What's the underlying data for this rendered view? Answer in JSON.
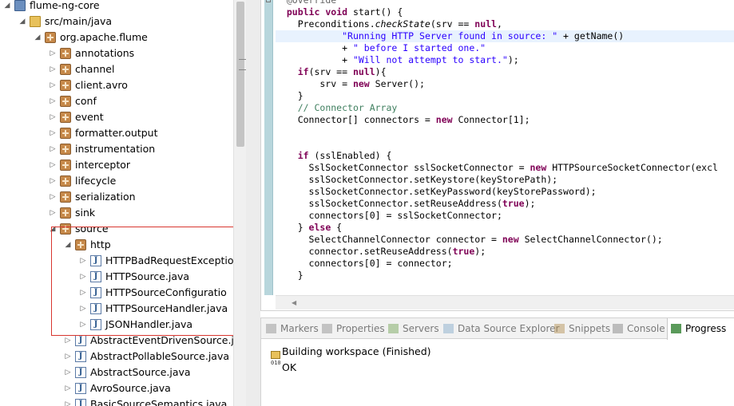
{
  "explorer": {
    "rows": [
      {
        "label": "flume-ng-core",
        "kind": "project",
        "arrow": "expanded",
        "indent": 0
      },
      {
        "label": "src/main/java",
        "kind": "folder",
        "arrow": "expanded",
        "indent": 1
      },
      {
        "label": "org.apache.flume",
        "kind": "package",
        "arrow": "expanded",
        "indent": 2
      },
      {
        "label": "annotations",
        "kind": "package",
        "arrow": "collapsed",
        "indent": 3
      },
      {
        "label": "channel",
        "kind": "package",
        "arrow": "collapsed",
        "indent": 3
      },
      {
        "label": "client.avro",
        "kind": "package",
        "arrow": "collapsed",
        "indent": 3
      },
      {
        "label": "conf",
        "kind": "package",
        "arrow": "collapsed",
        "indent": 3
      },
      {
        "label": "event",
        "kind": "package",
        "arrow": "collapsed",
        "indent": 3
      },
      {
        "label": "formatter.output",
        "kind": "package",
        "arrow": "collapsed",
        "indent": 3
      },
      {
        "label": "instrumentation",
        "kind": "package",
        "arrow": "collapsed",
        "indent": 3
      },
      {
        "label": "interceptor",
        "kind": "package",
        "arrow": "collapsed",
        "indent": 3
      },
      {
        "label": "lifecycle",
        "kind": "package",
        "arrow": "collapsed",
        "indent": 3
      },
      {
        "label": "serialization",
        "kind": "package",
        "arrow": "collapsed",
        "indent": 3
      },
      {
        "label": "sink",
        "kind": "package",
        "arrow": "collapsed",
        "indent": 3
      },
      {
        "label": "source",
        "kind": "package",
        "arrow": "expanded",
        "indent": 3
      },
      {
        "label": "http",
        "kind": "package",
        "arrow": "expanded",
        "indent": 4
      },
      {
        "label": "HTTPBadRequestExceptio",
        "kind": "java",
        "arrow": "collapsed",
        "indent": 5
      },
      {
        "label": "HTTPSource.java",
        "kind": "java",
        "arrow": "collapsed",
        "indent": 5
      },
      {
        "label": "HTTPSourceConfiguratio",
        "kind": "java",
        "arrow": "collapsed",
        "indent": 5
      },
      {
        "label": "HTTPSourceHandler.java",
        "kind": "java",
        "arrow": "collapsed",
        "indent": 5
      },
      {
        "label": "JSONHandler.java",
        "kind": "java",
        "arrow": "collapsed",
        "indent": 5
      },
      {
        "label": "AbstractEventDrivenSource.j",
        "kind": "java",
        "arrow": "collapsed",
        "indent": 4
      },
      {
        "label": "AbstractPollableSource.java",
        "kind": "java",
        "arrow": "collapsed",
        "indent": 4
      },
      {
        "label": "AbstractSource.java",
        "kind": "java",
        "arrow": "collapsed",
        "indent": 4
      },
      {
        "label": "AvroSource.java",
        "kind": "java",
        "arrow": "collapsed",
        "indent": 4
      },
      {
        "label": "BasicSourceSemantics.java",
        "kind": "java",
        "arrow": "collapsed",
        "indent": 4
      }
    ]
  },
  "editor": {
    "lines": [
      [
        {
          "t": "  "
        },
        {
          "t": "@Override",
          "c": "ann"
        }
      ],
      [
        {
          "t": "  "
        },
        {
          "t": "public",
          "c": "kw"
        },
        {
          "t": " "
        },
        {
          "t": "void",
          "c": "kw"
        },
        {
          "t": " start() {"
        }
      ],
      [
        {
          "t": "    Preconditions."
        },
        {
          "t": "checkState",
          "c": "it"
        },
        {
          "t": "(srv == "
        },
        {
          "t": "null",
          "c": "kw"
        },
        {
          "t": ","
        }
      ],
      [
        {
          "t": "            "
        },
        {
          "t": "\"Running HTTP Server found in source: \"",
          "c": "str"
        },
        {
          "t": " + getName()"
        }
      ],
      [
        {
          "t": "            + "
        },
        {
          "t": "\" before I started one.\"",
          "c": "str"
        }
      ],
      [
        {
          "t": "            + "
        },
        {
          "t": "\"Will not attempt to start.\"",
          "c": "str"
        },
        {
          "t": ");"
        }
      ],
      [
        {
          "t": "    "
        },
        {
          "t": "if",
          "c": "kw"
        },
        {
          "t": "(srv == "
        },
        {
          "t": "null",
          "c": "kw"
        },
        {
          "t": "){"
        }
      ],
      [
        {
          "t": "        srv = "
        },
        {
          "t": "new",
          "c": "kw"
        },
        {
          "t": " Server();"
        }
      ],
      [
        {
          "t": "    }"
        }
      ],
      [
        {
          "t": "    "
        },
        {
          "t": "// Connector Array",
          "c": "cmt"
        }
      ],
      [
        {
          "t": "    Connector[] connectors = "
        },
        {
          "t": "new",
          "c": "kw"
        },
        {
          "t": " Connector[1];"
        }
      ],
      [],
      [],
      [
        {
          "t": "    "
        },
        {
          "t": "if",
          "c": "kw"
        },
        {
          "t": " (sslEnabled) {"
        }
      ],
      [
        {
          "t": "      SslSocketConnector sslSocketConnector = "
        },
        {
          "t": "new",
          "c": "kw"
        },
        {
          "t": " HTTPSourceSocketConnector(excl"
        }
      ],
      [
        {
          "t": "      sslSocketConnector.setKeystore(keyStorePath);"
        }
      ],
      [
        {
          "t": "      sslSocketConnector.setKeyPassword(keyStorePassword);"
        }
      ],
      [
        {
          "t": "      sslSocketConnector.setReuseAddress("
        },
        {
          "t": "true",
          "c": "kw"
        },
        {
          "t": ");"
        }
      ],
      [
        {
          "t": "      connectors[0] = sslSocketConnector;"
        }
      ],
      [
        {
          "t": "    } "
        },
        {
          "t": "else",
          "c": "kw"
        },
        {
          "t": " {"
        }
      ],
      [
        {
          "t": "      SelectChannelConnector connector = "
        },
        {
          "t": "new",
          "c": "kw"
        },
        {
          "t": " SelectChannelConnector();"
        }
      ],
      [
        {
          "t": "      connector.setReuseAddress("
        },
        {
          "t": "true",
          "c": "kw"
        },
        {
          "t": ");"
        }
      ],
      [
        {
          "t": "      connectors[0] = connector;"
        }
      ],
      [
        {
          "t": "    }"
        }
      ]
    ],
    "current_line_index": 3
  },
  "views": {
    "tabs": [
      {
        "label": "Markers",
        "icon": "markers-icon",
        "active": false
      },
      {
        "label": "Properties",
        "icon": "properties-icon",
        "active": false
      },
      {
        "label": "Servers",
        "icon": "servers-icon",
        "active": false
      },
      {
        "label": "Data Source Explorer",
        "icon": "data-source-icon",
        "active": false
      },
      {
        "label": "Snippets",
        "icon": "snippets-icon",
        "active": false
      },
      {
        "label": "Console",
        "icon": "console-icon",
        "active": false
      },
      {
        "label": "Progress",
        "icon": "progress-icon",
        "active": true
      }
    ],
    "progress": {
      "job_name": "Building workspace (Finished)",
      "job_status": "OK",
      "close_glyph": "✕"
    }
  },
  "colors": {
    "keyword": "#7f0055",
    "string": "#2a00ff",
    "comment": "#3f7f5f",
    "annotation": "#646464",
    "highlight_box": "#d8362f"
  }
}
